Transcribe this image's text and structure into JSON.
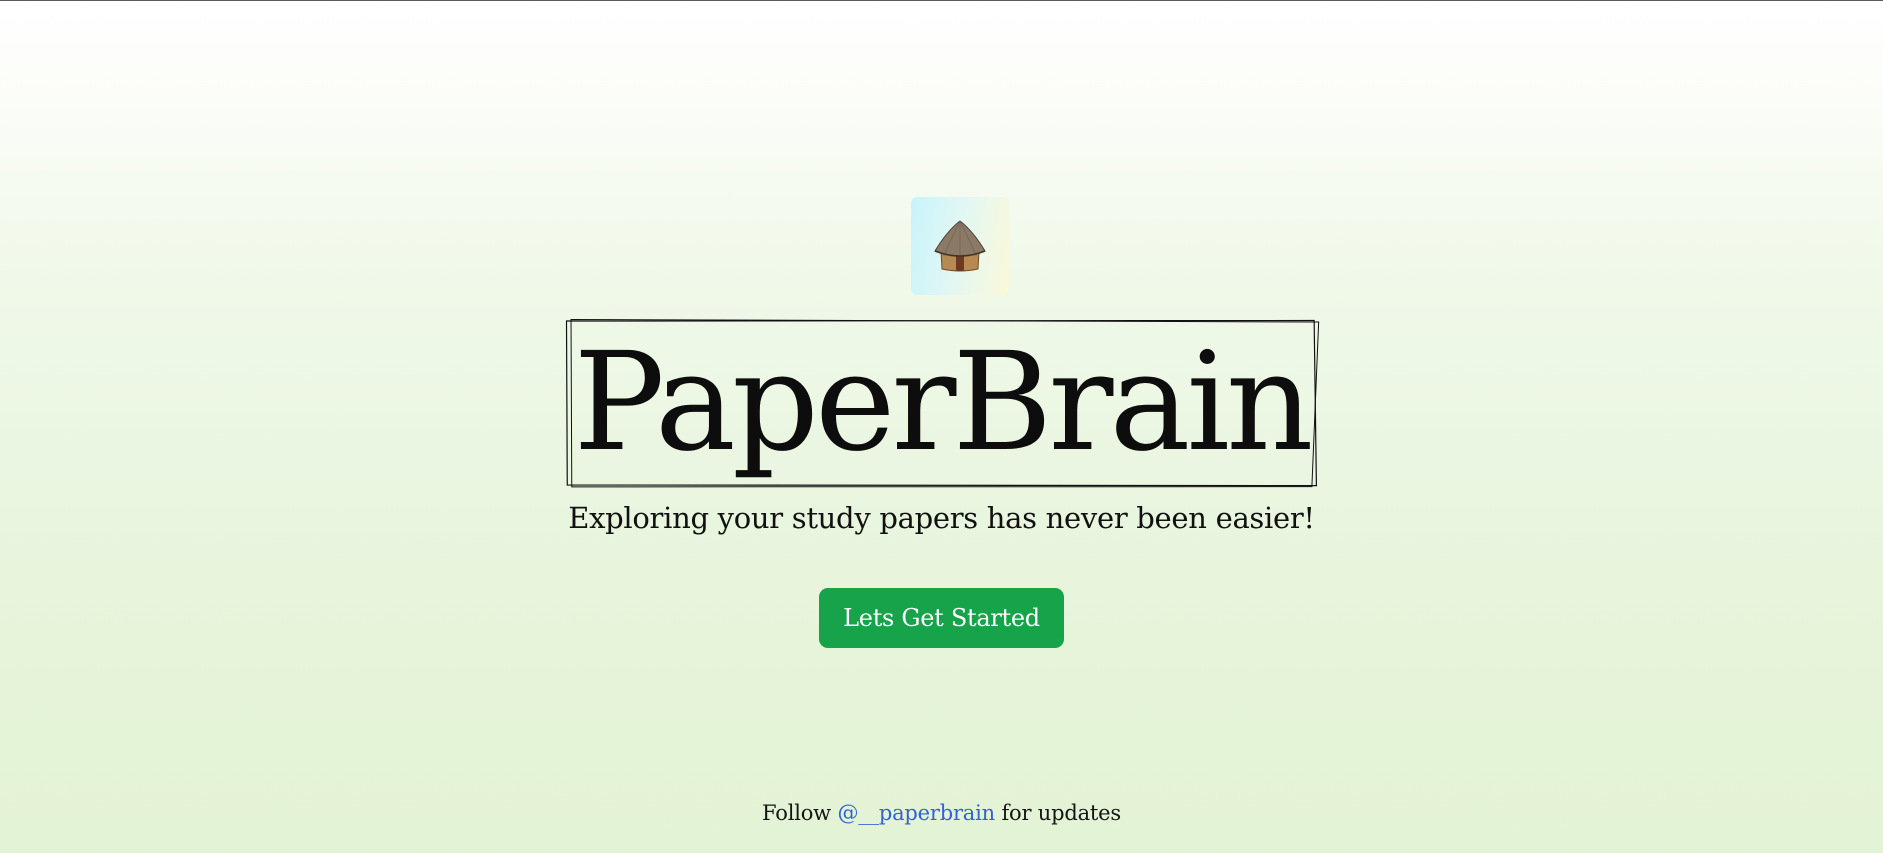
{
  "logo": {
    "icon": "hut-icon"
  },
  "hero": {
    "title": "PaperBrain",
    "subtitle": "Exploring your study papers has never been easier!"
  },
  "cta": {
    "label": "Lets Get Started",
    "color": "#16a34a"
  },
  "footer": {
    "prefix": "Follow",
    "handle": "@__paperbrain",
    "suffix": "for updates",
    "link_color": "#2f63d6"
  }
}
